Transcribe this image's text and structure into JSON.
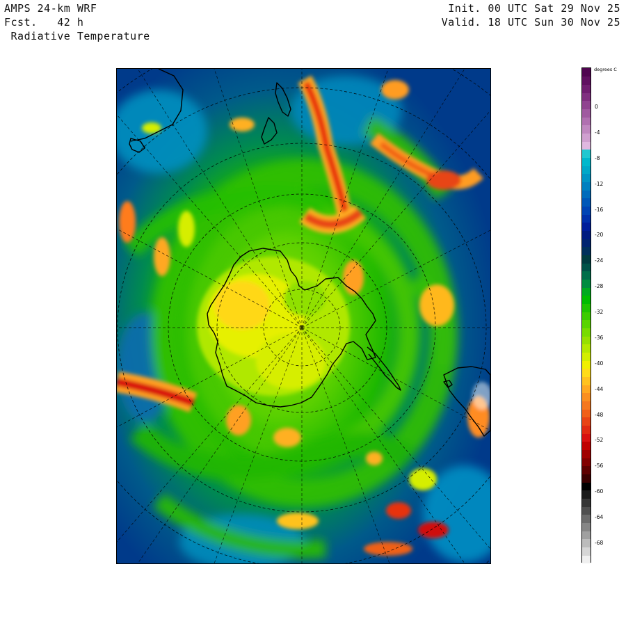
{
  "header": {
    "model": "AMPS 24-km WRF",
    "forecast_label": "Fcst.",
    "forecast_value": "42 h",
    "field": "Radiative Temperature",
    "init": "Init. 00 UTC Sat 29 Nov 25",
    "valid": "Valid. 18 UTC Sun 30 Nov 25"
  },
  "map": {
    "projection": "polar-stereographic",
    "hemisphere": "south",
    "graticule": "dashed",
    "coastlines": "Antarctica, New Zealand, Tasmania, South America (tip)"
  },
  "colorbar": {
    "unit": "degrees C",
    "ticks": [
      "0",
      "-4",
      "-8",
      "-12",
      "-16",
      "-20",
      "-24",
      "-28",
      "-32",
      "-36",
      "-40",
      "-44",
      "-48",
      "-52",
      "-56",
      "-60",
      "-64",
      "-68"
    ],
    "colors": [
      "#f0f0f0",
      "#d6d6d6",
      "#bcbcbc",
      "#a0a0a0",
      "#868686",
      "#6c6c6c",
      "#505050",
      "#363636",
      "#1a1a1a",
      "#000000",
      "#3a0000",
      "#5e0000",
      "#820000",
      "#a00000",
      "#c00000",
      "#d81010",
      "#e02a12",
      "#e84416",
      "#f0601a",
      "#f5781e",
      "#fa8f20",
      "#ffa820",
      "#ffc21e",
      "#ffdc18",
      "#f0f000",
      "#d2ee00",
      "#b4e800",
      "#96e000",
      "#78dc00",
      "#5ad400",
      "#3ccc00",
      "#1ec400",
      "#00bc00",
      "#00aa20",
      "#008c40",
      "#006e4a",
      "#005248",
      "#003c40",
      "#00305c",
      "#002470",
      "#001c80",
      "#001e9a",
      "#0030aa",
      "#0044b4",
      "#0058b8",
      "#006cbc",
      "#0080c0",
      "#0094c4",
      "#00a8c8",
      "#00b8cc",
      "#20c8d0",
      "#e0b8e0",
      "#d0a0d0",
      "#c088c0",
      "#b070b0",
      "#a05aa0",
      "#904490",
      "#803080",
      "#701e70",
      "#601060",
      "#500550"
    ]
  }
}
